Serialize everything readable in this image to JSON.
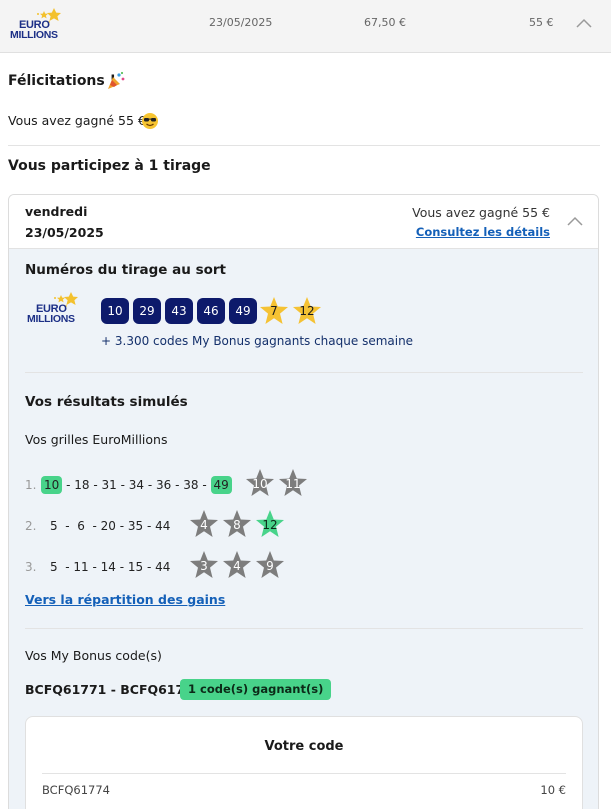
{
  "logo": {
    "line1": "EURO",
    "line2": "MILLIONS"
  },
  "summary": {
    "date": "23/05/2025",
    "price": "67,50 €",
    "won": "55 €"
  },
  "congrats": {
    "title": "Félicitations !",
    "won_text": "Vous avez gagné 55 €"
  },
  "participate": "Vous participez à 1 tirage",
  "draw": {
    "day": "vendredi",
    "date": "23/05/2025",
    "won_text": "Vous avez gagné 55 €",
    "details_link": "Consultez les détails",
    "numbers_title": "Numéros du tirage au sort",
    "balls": [
      "10",
      "29",
      "43",
      "46",
      "49"
    ],
    "stars": [
      "7",
      "12"
    ],
    "bonus_note": "+ 3.300 codes My Bonus gagnants chaque semaine"
  },
  "results": {
    "title": "Vos résultats simulés",
    "grids_label": "Vos grilles EuroMillions",
    "grids": [
      {
        "index": "1.",
        "numbers": [
          "10",
          "18",
          "31",
          "34",
          "36",
          "38",
          "49"
        ],
        "stars": [
          "10",
          "11"
        ]
      },
      {
        "index": "2.",
        "numbers": [
          "5",
          "6",
          "20",
          "35",
          "44"
        ],
        "stars": [
          "4",
          "8",
          "12"
        ]
      },
      {
        "index": "3.",
        "numbers": [
          "5",
          "11",
          "14",
          "15",
          "44"
        ],
        "stars": [
          "3",
          "4",
          "9"
        ]
      }
    ],
    "repartition_link": "Vers la répartition des gains"
  },
  "bonus": {
    "label": "Vos My Bonus code(s)",
    "codes_range": "BCFQ61771 - BCFQ61797",
    "winning_badge": "1 code(s) gagnant(s)",
    "box_title": "Votre code",
    "code": "BCFQ61774",
    "amount": "10 €"
  },
  "colors": {
    "ball": "#0d1a6b",
    "star_gold": "#f5c233",
    "star_gray": "#7d7d7d",
    "hit_green": "#48d38a",
    "link": "#1460b8"
  }
}
